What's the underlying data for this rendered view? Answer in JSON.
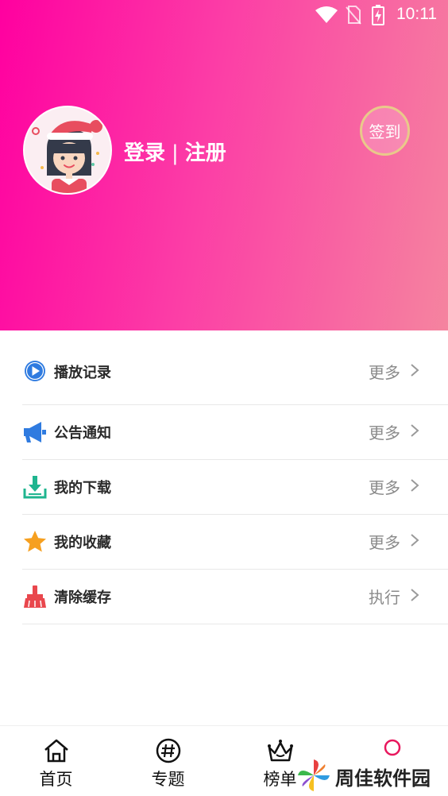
{
  "status_bar": {
    "time": "10:11"
  },
  "profile": {
    "login_label": "登录",
    "separator": "|",
    "register_label": "注册",
    "checkin_label": "签到"
  },
  "menu": {
    "items": [
      {
        "label": "播放记录",
        "action": "更多",
        "icon": "play-circle-icon",
        "color": "#2f7be0"
      },
      {
        "label": "公告通知",
        "action": "更多",
        "icon": "megaphone-icon",
        "color": "#2f7be0"
      },
      {
        "label": "我的下载",
        "action": "更多",
        "icon": "download-icon",
        "color": "#1fb58f"
      },
      {
        "label": "我的收藏",
        "action": "更多",
        "icon": "star-icon",
        "color": "#f6a020"
      },
      {
        "label": "清除缓存",
        "action": "执行",
        "icon": "broom-icon",
        "color": "#e9474d"
      }
    ]
  },
  "tabbar": {
    "tabs": [
      {
        "label": "首页",
        "icon": "home-icon"
      },
      {
        "label": "专题",
        "icon": "hashtag-icon"
      },
      {
        "label": "榜单",
        "icon": "crown-icon"
      },
      {
        "label": "",
        "icon": "profile-icon",
        "active": true
      }
    ]
  },
  "watermark": {
    "text": "周佳软件园"
  },
  "colors": {
    "header_start": "#ff00a0",
    "header_end": "#f5849f",
    "active_tab": "#e8175d"
  }
}
